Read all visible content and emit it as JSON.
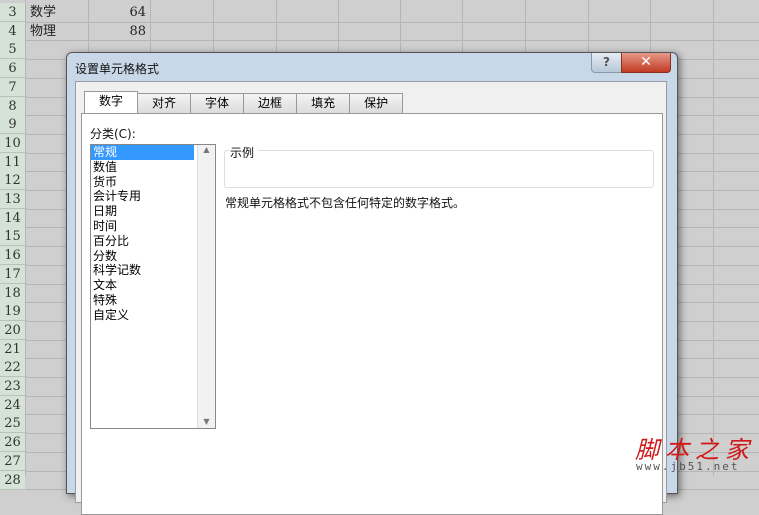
{
  "sheet": {
    "rows": [
      "3",
      "4",
      "5",
      "6",
      "7",
      "8",
      "9",
      "10",
      "11",
      "12",
      "13",
      "14",
      "15",
      "16",
      "17",
      "18",
      "19",
      "20",
      "21",
      "22",
      "23",
      "24",
      "25",
      "26",
      "27",
      "28"
    ],
    "cells": [
      {
        "label": "数学",
        "value": "64"
      },
      {
        "label": "物理",
        "value": "88"
      }
    ]
  },
  "dialog": {
    "title": "设置单元格格式",
    "help": "?",
    "close": "✕",
    "tabs": [
      "数字",
      "对齐",
      "字体",
      "边框",
      "填充",
      "保护"
    ],
    "category_label": "分类(C):",
    "categories": [
      "常规",
      "数值",
      "货币",
      "会计专用",
      "日期",
      "时间",
      "百分比",
      "分数",
      "科学记数",
      "文本",
      "特殊",
      "自定义"
    ],
    "sample_label": "示例",
    "description": "常规单元格格式不包含任何特定的数字格式。"
  },
  "watermark": {
    "name": "脚本之家",
    "url": "www.jb51.net"
  }
}
